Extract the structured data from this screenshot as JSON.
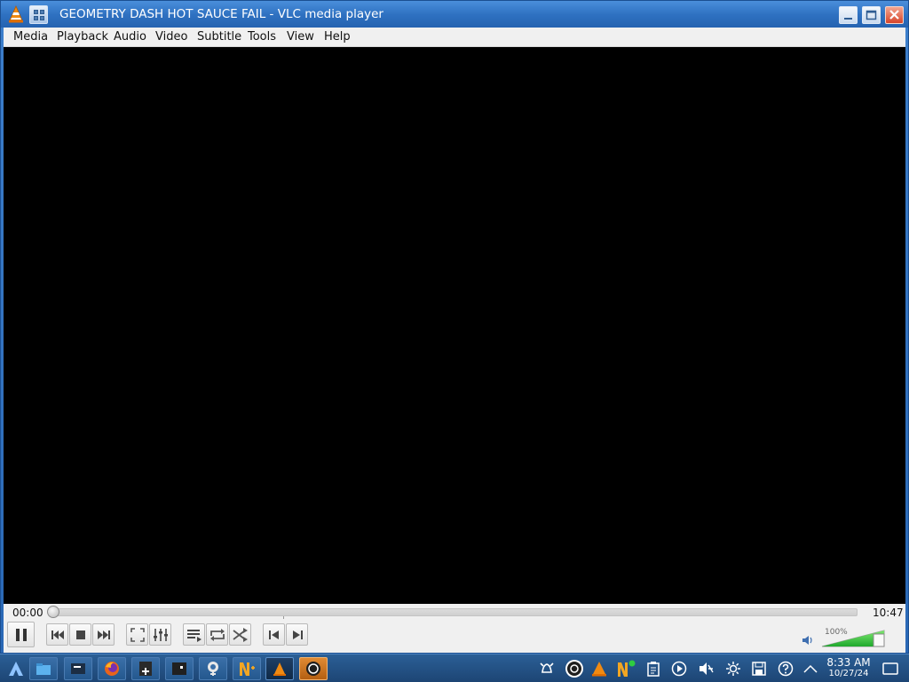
{
  "window": {
    "title": "GEOMETRY DASH HOT SAUCE FAIL - VLC media player"
  },
  "menubar": {
    "items": [
      {
        "label": "Media"
      },
      {
        "label": "Playback"
      },
      {
        "label": "Audio"
      },
      {
        "label": "Video"
      },
      {
        "label": "Subtitle"
      },
      {
        "label": "Tools"
      },
      {
        "label": "View"
      },
      {
        "label": "Help"
      }
    ]
  },
  "player": {
    "elapsed": "00:00",
    "duration": "10:47",
    "seek_position_fraction": 0.0,
    "volume_label": "100%",
    "volume_fraction": 1.0
  },
  "controls": {
    "icons": [
      "pause-icon",
      "previous-icon",
      "stop-icon",
      "next-icon",
      "fullscreen-icon",
      "extended-settings-icon",
      "playlist-icon",
      "loop-icon",
      "shuffle-icon",
      "frame-back-icon",
      "frame-forward-icon",
      "speaker-icon"
    ]
  },
  "taskbar": {
    "apps": [
      "start-menu-icon",
      "file-manager-icon",
      "terminal-icon",
      "firefox-icon",
      "calculator-icon",
      "app-icon",
      "settings-icon",
      "text-app-icon",
      "vlc-icon",
      "obs-icon"
    ],
    "tray": [
      "notification-bell-icon",
      "obs-tray-icon",
      "vlc-tray-icon",
      "app-tray-icon",
      "clipboard-icon",
      "media-player-icon",
      "volume-muted-icon",
      "brightness-icon",
      "save-icon",
      "help-icon",
      "show-hidden-icon",
      "show-desktop-icon"
    ],
    "clock_time": "8:33 AM",
    "clock_date": "10/27/24"
  },
  "colors": {
    "title_bar": "#2f72c2",
    "taskbar": "#1d4574",
    "volume_fill": "#2ecc40",
    "close_button": "#d8452a"
  }
}
